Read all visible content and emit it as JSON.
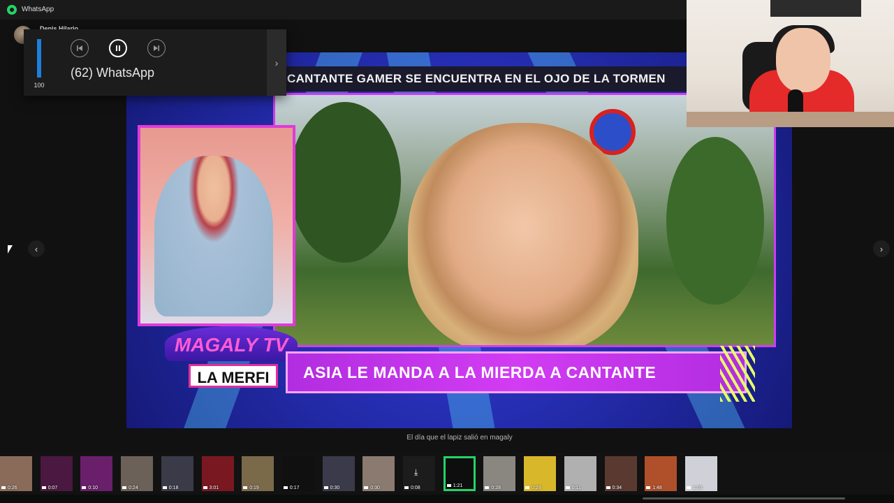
{
  "window": {
    "title": "WhatsApp"
  },
  "sender": {
    "name": "Denis Hilario"
  },
  "media_flyout": {
    "volume_value": "100",
    "volume_level_percent": 100,
    "track_title": "(62) WhatsApp",
    "expand_glyph": "›",
    "controls": [
      "previous-track-icon",
      "pause-icon",
      "next-track-icon"
    ]
  },
  "video": {
    "top_banner": "CANTANTE GAMER SE ENCUENTRA EN EL OJO DE LA TORMEN",
    "logo_title": "MAGALY TV",
    "logo_subtitle": "LA MERFI",
    "ticker": "ASIA LE MANDA A LA MIERDA A CANTANTE"
  },
  "caption": "El día que el lapiz salió en magaly",
  "nav": {
    "prev": "‹",
    "next": "›"
  },
  "thumbnails": [
    {
      "duration": "0:26"
    },
    {
      "duration": "0:07"
    },
    {
      "duration": "0:10"
    },
    {
      "duration": "0:24"
    },
    {
      "duration": "0:18"
    },
    {
      "duration": "3:01"
    },
    {
      "duration": "0:19"
    },
    {
      "duration": "0:17"
    },
    {
      "duration": "0:30"
    },
    {
      "duration": "0:30"
    },
    {
      "duration": "0:08",
      "download": true
    },
    {
      "duration": "1:21",
      "selected": true
    },
    {
      "duration": "0:28"
    },
    {
      "duration": "0:29"
    },
    {
      "duration": "0:11"
    },
    {
      "duration": "0:34"
    },
    {
      "duration": "1:48"
    },
    {
      "duration": "1:00"
    }
  ],
  "colors": {
    "accent": "#25d366",
    "volume": "#1e7fdc",
    "ticker": "#c935ea"
  }
}
